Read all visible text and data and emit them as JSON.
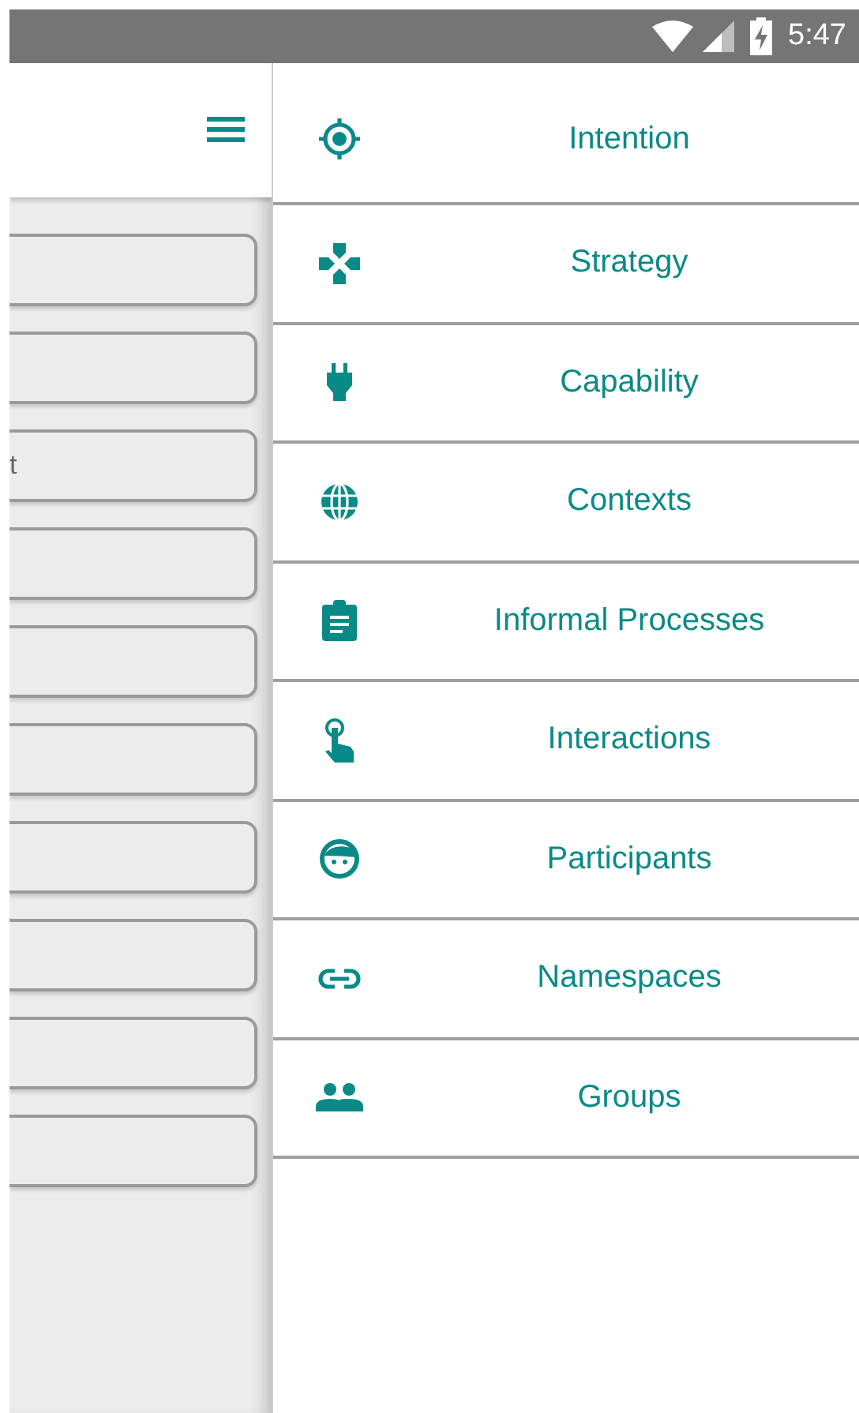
{
  "status_bar": {
    "time": "5:47"
  },
  "background_screen": {
    "cut_off_text": "t"
  },
  "drawer": {
    "items": [
      {
        "label": "Intention"
      },
      {
        "label": "Strategy"
      },
      {
        "label": "Capability"
      },
      {
        "label": "Contexts"
      },
      {
        "label": "Informal Processes"
      },
      {
        "label": "Interactions"
      },
      {
        "label": "Participants"
      },
      {
        "label": "Namespaces"
      },
      {
        "label": "Groups"
      }
    ]
  }
}
